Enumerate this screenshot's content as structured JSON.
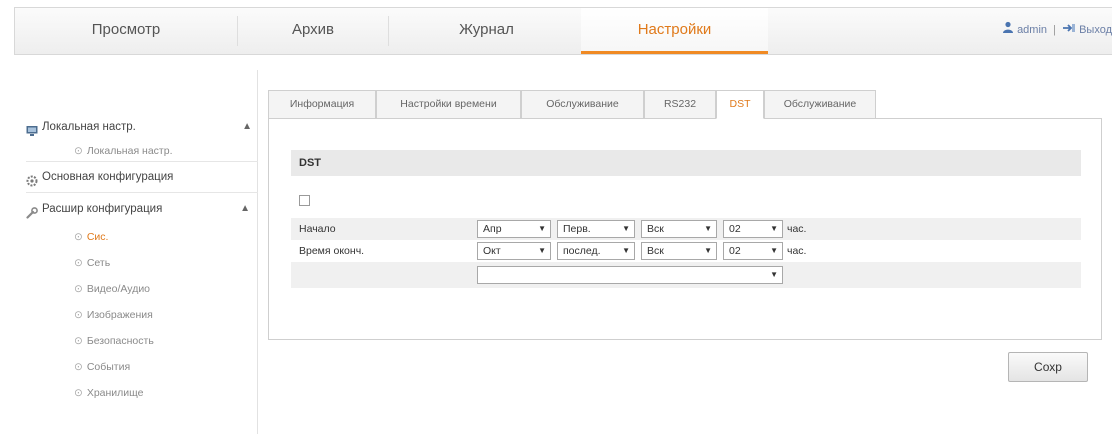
{
  "topnav": {
    "items": [
      {
        "label": "Просмотр"
      },
      {
        "label": "Архив"
      },
      {
        "label": "Журнал"
      },
      {
        "label": "Настройки"
      }
    ],
    "active_index": 3,
    "user": "admin",
    "separator": "|",
    "logout": "Выход"
  },
  "sidebar": {
    "local": {
      "label": "Локальная настр.",
      "toggle": "▲",
      "sub": "Локальная настр."
    },
    "basic": {
      "label": "Основная конфигурация"
    },
    "advanced": {
      "label": "Расшир конфигурация",
      "toggle": "▲",
      "items": [
        "Сис.",
        "Сеть",
        "Видео/Аудио",
        "Изображения",
        "Безопасность",
        "События",
        "Хранилище"
      ],
      "active_index": 0
    }
  },
  "tabs": {
    "items": [
      "Информация",
      "Настройки времени",
      "Обслуживание",
      "RS232",
      "DST",
      "Обслуживание"
    ],
    "active_index": 4
  },
  "dst": {
    "section_title": "DST",
    "enabled": false,
    "start": {
      "label": "Начало",
      "month": "Апр",
      "week": "Перв.",
      "day": "Вск",
      "hour": "02",
      "unit": "час."
    },
    "end": {
      "label": "Время оконч.",
      "month": "Окт",
      "week": "послед.",
      "day": "Вск",
      "hour": "02",
      "unit": "час."
    },
    "bias": {
      "value": ""
    }
  },
  "actions": {
    "save_label": "Сохр"
  },
  "colors": {
    "accent": "#e07a1b",
    "nav_underline": "#f08a24"
  }
}
